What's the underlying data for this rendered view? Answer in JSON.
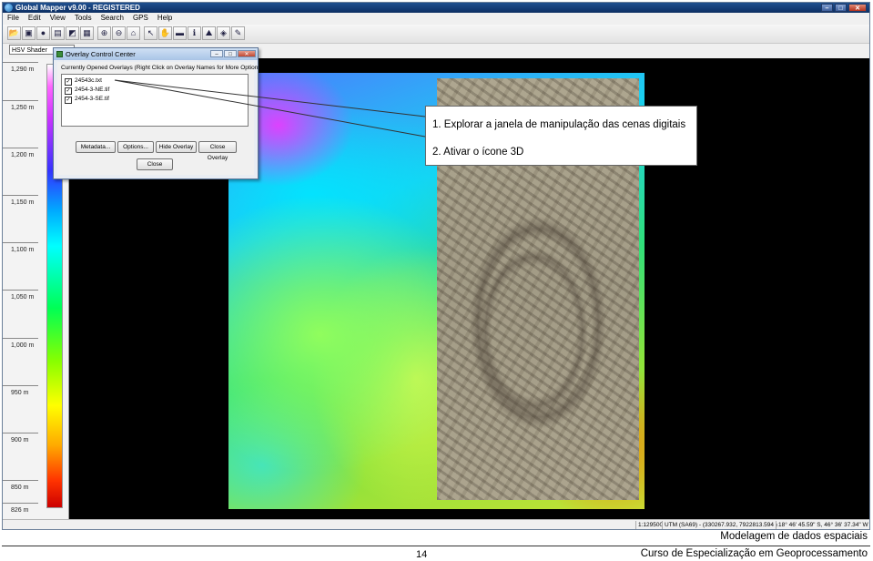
{
  "window": {
    "title": "Global Mapper v9.00 - REGISTERED",
    "buttons": [
      "–",
      "□",
      "✕"
    ]
  },
  "menu": [
    "File",
    "Edit",
    "View",
    "Tools",
    "Search",
    "GPS",
    "Help"
  ],
  "toolbar": {
    "icons": [
      "open-icon",
      "save-icon",
      "globe-icon",
      "layers-icon",
      "chart-icon",
      "config-icon",
      "zoom-in-icon",
      "zoom-out-icon",
      "home-icon",
      "select-icon",
      "pan-icon",
      "measure-icon",
      "info-icon",
      "path-profile-icon",
      "3d-view-icon",
      "digitizer-icon"
    ],
    "shader": "HSV Shader"
  },
  "legend": {
    "ticks": [
      "1,290 m",
      "1,250 m",
      "1,200 m",
      "1,150 m",
      "1,100 m",
      "1,050 m",
      "1,000 m",
      "950 m",
      "900 m",
      "850 m",
      "826 m"
    ]
  },
  "dialog": {
    "title": "Overlay Control Center",
    "list_label": "Currently Opened Overlays (Right Click on Overlay Names for More Options)",
    "overlays": [
      {
        "name": "24543c.txt",
        "checked": true
      },
      {
        "name": "2454-3-NE.tif",
        "checked": true
      },
      {
        "name": "2454-3-SE.tif",
        "checked": true
      }
    ],
    "buttons": {
      "metadata": "Metadata...",
      "options": "Options...",
      "hide": "Hide Overlay",
      "close_overlay": "Close Overlay",
      "close": "Close"
    }
  },
  "status": {
    "scale": "1:129500",
    "projection": "UTM (SA69) - (330267.932, 7922813.594 )",
    "coords": "18° 46' 45.59\" S, 46° 36' 37.34\" W"
  },
  "callout": {
    "line1": "1. Explorar a janela de manipulação das cenas digitais",
    "line2": "2. Ativar o ícone 3D"
  },
  "footer": {
    "topic": "Modelagem de dados espaciais",
    "page": "14",
    "course": "Curso de Especialização em Geoprocessamento"
  }
}
